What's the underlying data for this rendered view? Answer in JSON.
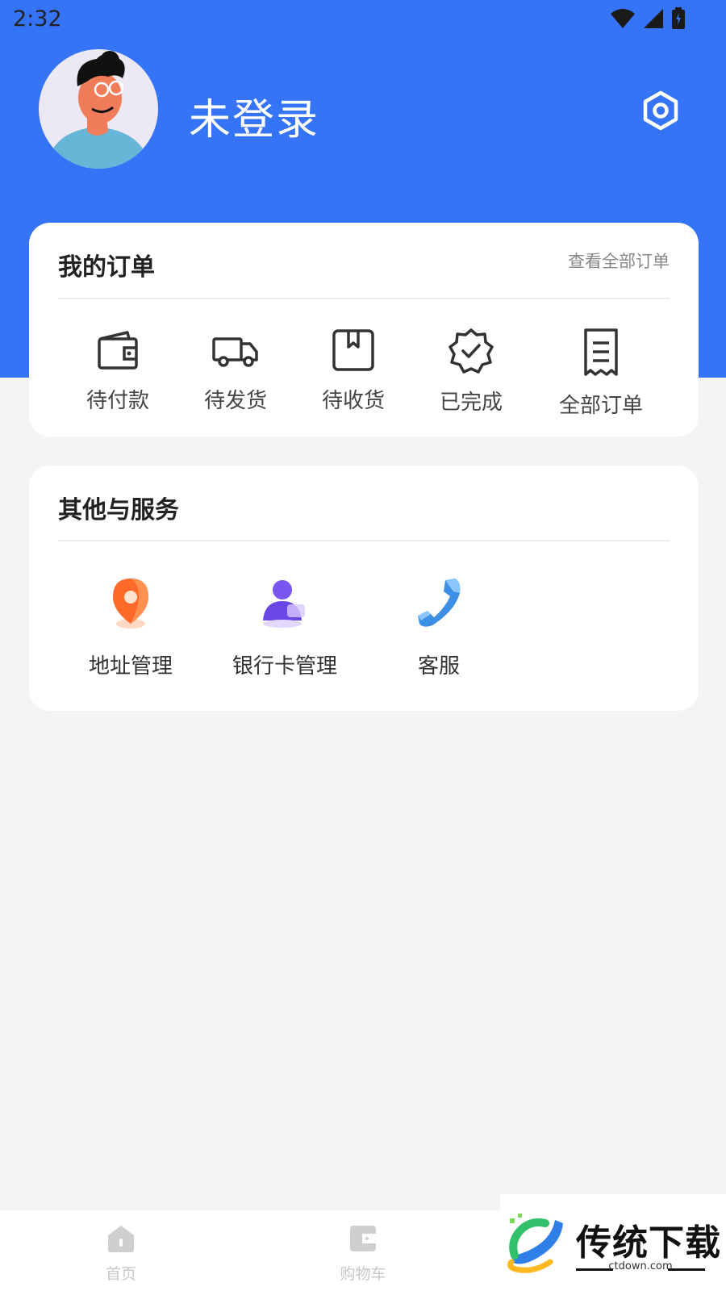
{
  "status_bar": {
    "time": "2:32",
    "icons": [
      "wifi-icon",
      "signal-icon",
      "battery-icon"
    ]
  },
  "header": {
    "username": "未登录",
    "settings_icon": "settings-hexagon-icon",
    "bg_color": "#3574f6"
  },
  "orders": {
    "title": "我的订单",
    "view_all": "查看全部订单",
    "items": [
      {
        "label": "待付款",
        "icon": "wallet-icon"
      },
      {
        "label": "待发货",
        "icon": "truck-icon"
      },
      {
        "label": "待收货",
        "icon": "bookmark-box-icon"
      },
      {
        "label": "已完成",
        "icon": "verified-badge-icon"
      },
      {
        "label": "全部订单",
        "icon": "receipt-icon"
      }
    ]
  },
  "services": {
    "title": "其他与服务",
    "items": [
      {
        "label": "地址管理",
        "icon": "location-pin-icon",
        "color": "#ff6a2b"
      },
      {
        "label": "银行卡管理",
        "icon": "user-card-icon",
        "color": "#7a55ee"
      },
      {
        "label": "客服",
        "icon": "phone-icon",
        "color": "#3d8fe6"
      }
    ]
  },
  "tabbar": {
    "items": [
      {
        "label": "首页",
        "icon": "home-icon"
      },
      {
        "label": "购物车",
        "icon": "cart-wallet-icon"
      }
    ]
  },
  "watermark": {
    "title": "传统下载",
    "subtitle": "ctdown.com"
  }
}
